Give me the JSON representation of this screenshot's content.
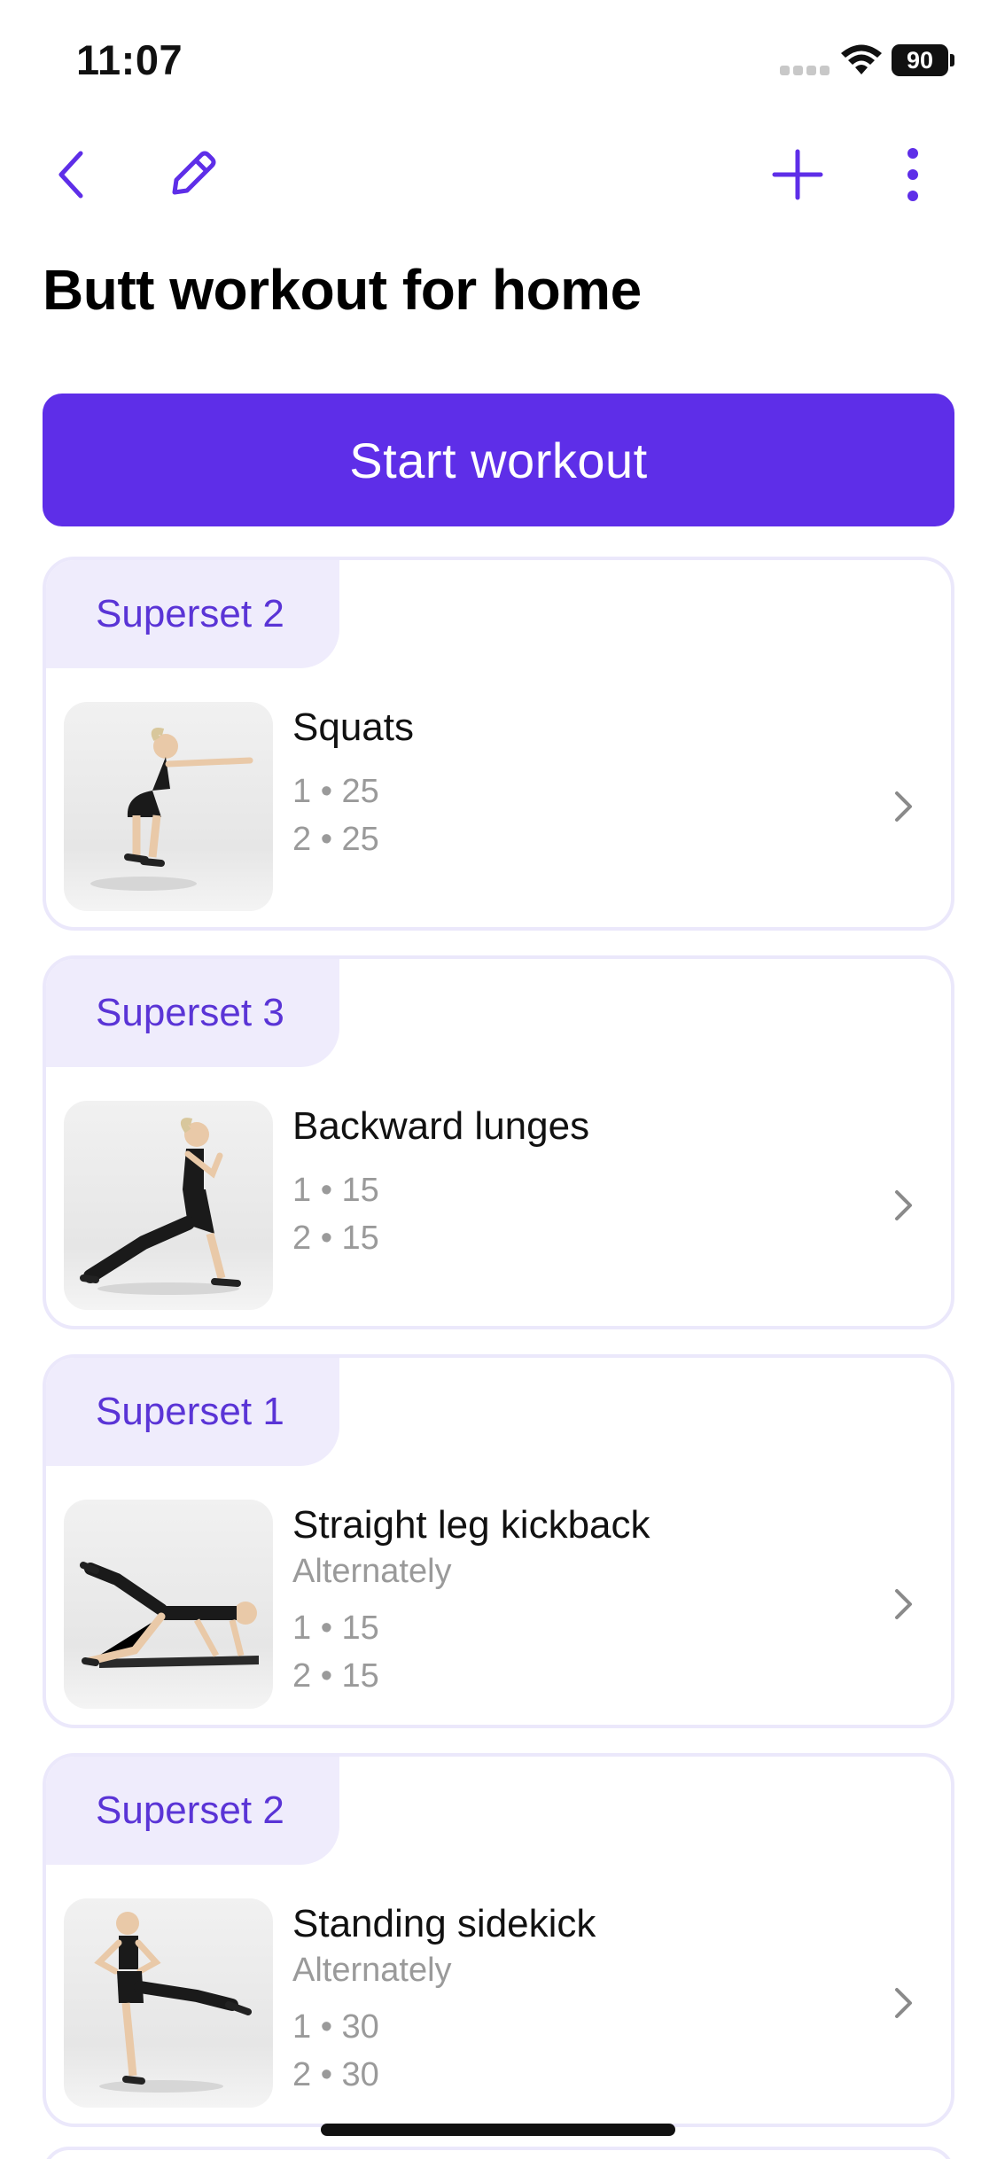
{
  "status_bar": {
    "time": "11:07",
    "battery": "90"
  },
  "nav": {
    "back_icon": "chevron-left-icon",
    "edit_icon": "pencil-icon",
    "add_icon": "plus-icon",
    "more_icon": "more-vertical-icon"
  },
  "title": "Butt workout for home",
  "start_button": "Start workout",
  "colors": {
    "accent": "#5e2ee8",
    "tag_bg": "#efecfc",
    "tag_text": "#5a34d6",
    "muted": "#9a9a9a"
  },
  "exercises": [
    {
      "superset": "Superset 2",
      "name": "Squats",
      "note": "",
      "sets": [
        "1 • 25",
        "2 • 25"
      ]
    },
    {
      "superset": "Superset 3",
      "name": "Backward lunges",
      "note": "",
      "sets": [
        "1 • 15",
        "2 • 15"
      ]
    },
    {
      "superset": "Superset 1",
      "name": "Straight leg kickback",
      "note": "Alternately",
      "sets": [
        "1 • 15",
        "2 • 15"
      ]
    },
    {
      "superset": "Superset 2",
      "name": "Standing sidekick",
      "note": "Alternately",
      "sets": [
        "1 • 30",
        "2 • 30"
      ]
    }
  ]
}
